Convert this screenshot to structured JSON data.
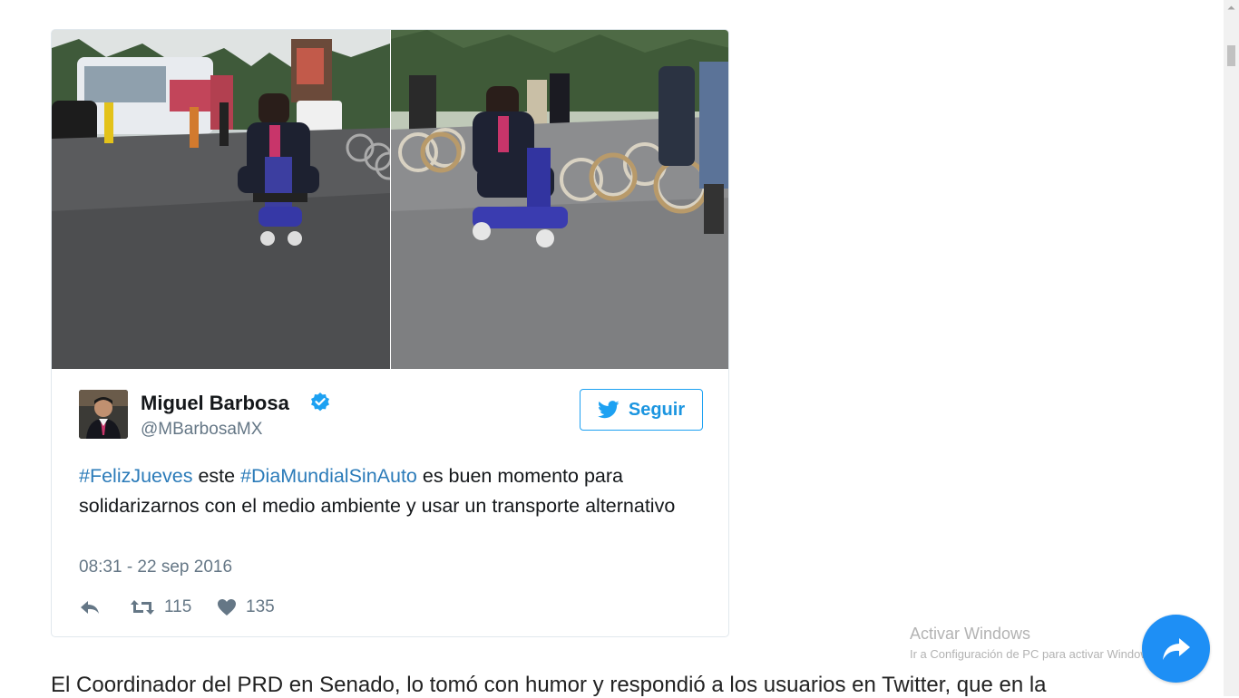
{
  "tweet": {
    "author_name": "Miguel Barbosa",
    "author_handle": "@MBarbosaMX",
    "follow_label": "Seguir",
    "text_parts": {
      "hashtag1": "#FelizJueves",
      "t1": " este ",
      "hashtag2": "#DiaMundialSinAuto",
      "t2": " es buen momento para solidarizarnos con el medio ambiente y usar un transporte alternativo"
    },
    "timestamp": "08:31 - 22 sep 2016",
    "retweet_count": "115",
    "like_count": "135",
    "icons": {
      "verified": "verified-badge-icon",
      "bird": "twitter-bird-icon",
      "reply": "reply-icon",
      "retweet": "retweet-icon",
      "like": "heart-icon"
    },
    "colors": {
      "link": "#2b7bb9",
      "accent": "#1da1f2",
      "muted": "#657786"
    }
  },
  "watermark": {
    "title": "Activar Windows",
    "subtitle": "Ir a Configuración de PC para activar Windows"
  },
  "article": {
    "paragraph_start": "El Coordinador del PRD en Senado, lo tomó con humor y respondió a los usuarios en Twitter, que en la"
  },
  "share_button": {
    "icon": "share-icon",
    "color": "#1e8ff5"
  }
}
